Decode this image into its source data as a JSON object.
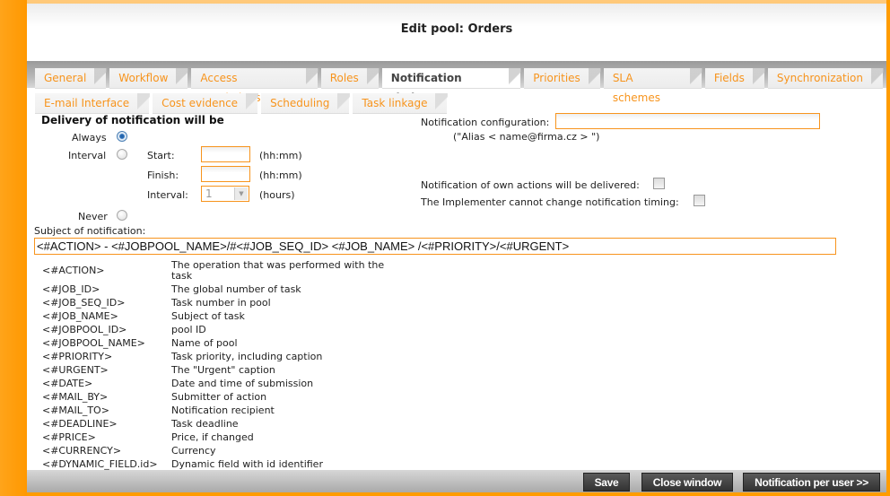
{
  "window": {
    "title": "Edit pool: Orders"
  },
  "tabs_row1": [
    {
      "label": "General",
      "active": false
    },
    {
      "label": "Workflow",
      "active": false
    },
    {
      "label": "Access restrictions",
      "active": false
    },
    {
      "label": "Roles",
      "active": false
    },
    {
      "label": "Notification timing",
      "active": true
    },
    {
      "label": "Priorities",
      "active": false
    },
    {
      "label": "SLA schemes",
      "active": false
    },
    {
      "label": "Fields",
      "active": false
    },
    {
      "label": "Synchronization",
      "active": false
    }
  ],
  "tabs_row2": [
    {
      "label": "E-mail Interface"
    },
    {
      "label": "Cost evidence"
    },
    {
      "label": "Scheduling"
    },
    {
      "label": "Task linkage"
    }
  ],
  "delivery": {
    "heading": "Delivery of notification will be",
    "options": {
      "always": "Always",
      "interval": "Interval",
      "never": "Never"
    },
    "selected": "always",
    "start_label": "Start:",
    "start_value": "",
    "finish_label": "Finish:",
    "finish_value": "",
    "interval_label": "Interval:",
    "interval_value": "1",
    "hhmm_hint": "(hh:mm)",
    "hours_hint": "(hours)"
  },
  "notification_config": {
    "label": "Notification configuration:",
    "value": "",
    "hint": "(\"Alias  < name@firma.cz > \")",
    "own_actions_label": "Notification of own actions will be delivered:",
    "own_actions_checked": false,
    "implementer_label": "The Implementer cannot change notification timing:",
    "implementer_checked": false
  },
  "subject": {
    "label": "Subject of notification:",
    "value": "<#ACTION> - <#JOBPOOL_NAME>/#<#JOB_SEQ_ID> <#JOB_NAME> /<#PRIORITY>/<#URGENT>"
  },
  "variables": [
    {
      "key": "<#ACTION>",
      "desc": "The operation that was performed with the task"
    },
    {
      "key": "<#JOB_ID>",
      "desc": "The global number of task"
    },
    {
      "key": "<#JOB_SEQ_ID>",
      "desc": "Task number in pool"
    },
    {
      "key": "<#JOB_NAME>",
      "desc": "Subject of task"
    },
    {
      "key": "<#JOBPOOL_ID>",
      "desc": "pool ID"
    },
    {
      "key": "<#JOBPOOL_NAME>",
      "desc": "Name of pool"
    },
    {
      "key": "<#PRIORITY>",
      "desc": "Task priority, including caption"
    },
    {
      "key": "<#URGENT>",
      "desc": "The \"Urgent\" caption"
    },
    {
      "key": "<#DATE>",
      "desc": "Date and time of submission"
    },
    {
      "key": "<#MAIL_BY>",
      "desc": "Submitter of action"
    },
    {
      "key": "<#MAIL_TO>",
      "desc": "Notification recipient"
    },
    {
      "key": "<#DEADLINE>",
      "desc": "Task deadline"
    },
    {
      "key": "<#PRICE>",
      "desc": "Price, if changed"
    },
    {
      "key": "<#CURRENCY>",
      "desc": "Currency"
    },
    {
      "key": "<#DYNAMIC_FIELD.id>",
      "desc": "Dynamic field with id identifier"
    }
  ],
  "buttons": {
    "save": "Save",
    "close": "Close window",
    "per_user": "Notification per user >>"
  },
  "colors": {
    "accent": "#f7941d",
    "frame": "#ff9c00",
    "button": "#3c3c3c"
  }
}
